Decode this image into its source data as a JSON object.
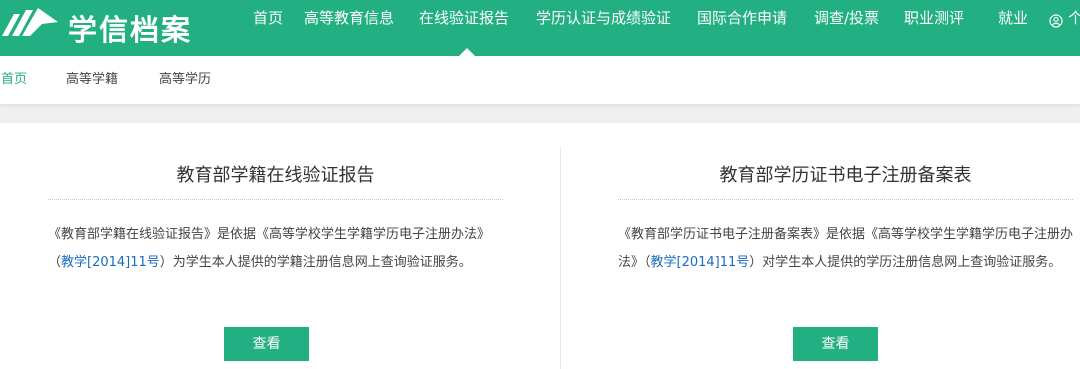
{
  "brand": {
    "name": "学信档案",
    "color": "#22b083"
  },
  "nav": {
    "items": [
      {
        "label": "首页"
      },
      {
        "label": "高等教育信息"
      },
      {
        "label": "在线验证报告",
        "active": true
      },
      {
        "label": "学历认证与成绩验证"
      },
      {
        "label": "国际合作申请"
      },
      {
        "label": "调查/投票"
      },
      {
        "label": "职业测评"
      },
      {
        "label": "就业"
      }
    ],
    "user_icon": "user-circle-icon",
    "user_label": "个"
  },
  "subnav": {
    "items": [
      {
        "label": "首页",
        "active": true
      },
      {
        "label": "高等学籍"
      },
      {
        "label": "高等学历"
      }
    ]
  },
  "cards": [
    {
      "title": "教育部学籍在线验证报告",
      "desc_before": "《教育部学籍在线验证报告》是依据《高等学校学生学籍学历电子注册办法》（",
      "desc_link": "教学[2014]11号",
      "desc_after": "）为学生本人提供的学籍注册信息网上查询验证服务。",
      "button_label": "查看"
    },
    {
      "title": "教育部学历证书电子注册备案表",
      "desc_before": "《教育部学历证书电子注册备案表》是依据《高等学校学生学籍学历电子注册办法》（",
      "desc_link": "教学[2014]11号",
      "desc_after": "）对学生本人提供的学历注册信息网上查询验证服务。",
      "button_label": "查看"
    }
  ]
}
